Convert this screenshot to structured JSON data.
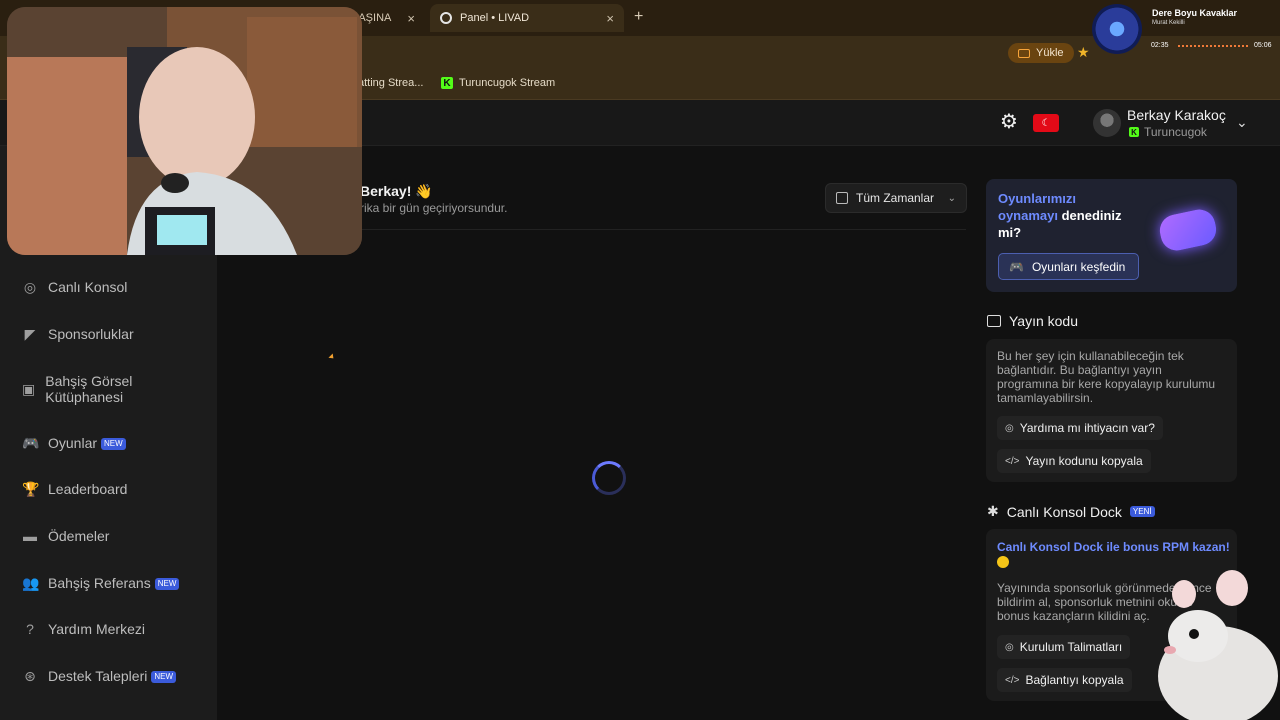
{
  "browser": {
    "tabs": [
      {
        "label": "N BAŞINA",
        "close": "×"
      },
      {
        "label": "Panel • LIVAD",
        "close": "×"
      }
    ],
    "new_tab": "+",
    "upload_label": "Yükle",
    "bookmarks": [
      "atting Strea...",
      "Turuncugok Stream"
    ]
  },
  "header": {
    "user_name": "Berkay Karakoç",
    "user_handle": "Turuncugok",
    "flag": "☾"
  },
  "sidebar": {
    "items": [
      {
        "label": "Canlı Konsol",
        "icon": "target-icon"
      },
      {
        "label": "Sponsorluklar",
        "icon": "megaphone-icon"
      },
      {
        "label": "Bahşiş Görsel Kütüphanesi",
        "icon": "image-plus-icon"
      },
      {
        "label": "Oyunlar",
        "icon": "gamepad-icon",
        "badge": "NEW"
      },
      {
        "label": "Leaderboard",
        "icon": "trophy-icon"
      },
      {
        "label": "Ödemeler",
        "icon": "wallet-icon"
      },
      {
        "label": "Bahşiş Referans",
        "icon": "users-icon",
        "badge": "NEW"
      },
      {
        "label": "Yardım Merkezi",
        "icon": "help-icon"
      },
      {
        "label": "Destek Talepleri",
        "icon": "lifebuoy-icon",
        "badge": "NEW"
      }
    ]
  },
  "main": {
    "greeting_title": "Berkay! 👋",
    "greeting_sub": "rika bir gün geçiriyorsundur.",
    "date_filter": "Tüm Zamanlar"
  },
  "promo": {
    "line1": "Oyunlarımızı",
    "line2_hl": "oynamayı",
    "line2_rest": " denediniz",
    "line3": "mi?",
    "button": "Oyunları keşfedin"
  },
  "stream_code": {
    "title": "Yayın kodu",
    "description": "Bu her şey için kullanabileceğin tek bağlantıdır. Bu bağlantıyı yayın programına bir kere kopyalayıp kurulumu tamamlayabilirsin.",
    "help_button": "Yardıma mı ihtiyacın var?",
    "copy_button": "Yayın kodunu kopyala"
  },
  "dock": {
    "title": "Canlı Konsol Dock",
    "badge": "YENİ",
    "link": "Canlı Konsol Dock ile bonus RPM kazan!",
    "description": "Yayınında sponsorluk görünmeden önce bildirim al, sponsorluk metnini oku ve bonus kazançların kilidini aç.",
    "setup_button": "Kurulum Talimatları",
    "copy_button": "Bağlantıyı kopyala"
  },
  "music": {
    "title": "Dere Boyu Kavaklar",
    "artist": "Murat Kekilli",
    "current": "02:35",
    "total": "05:06",
    "progress": 0.5
  }
}
